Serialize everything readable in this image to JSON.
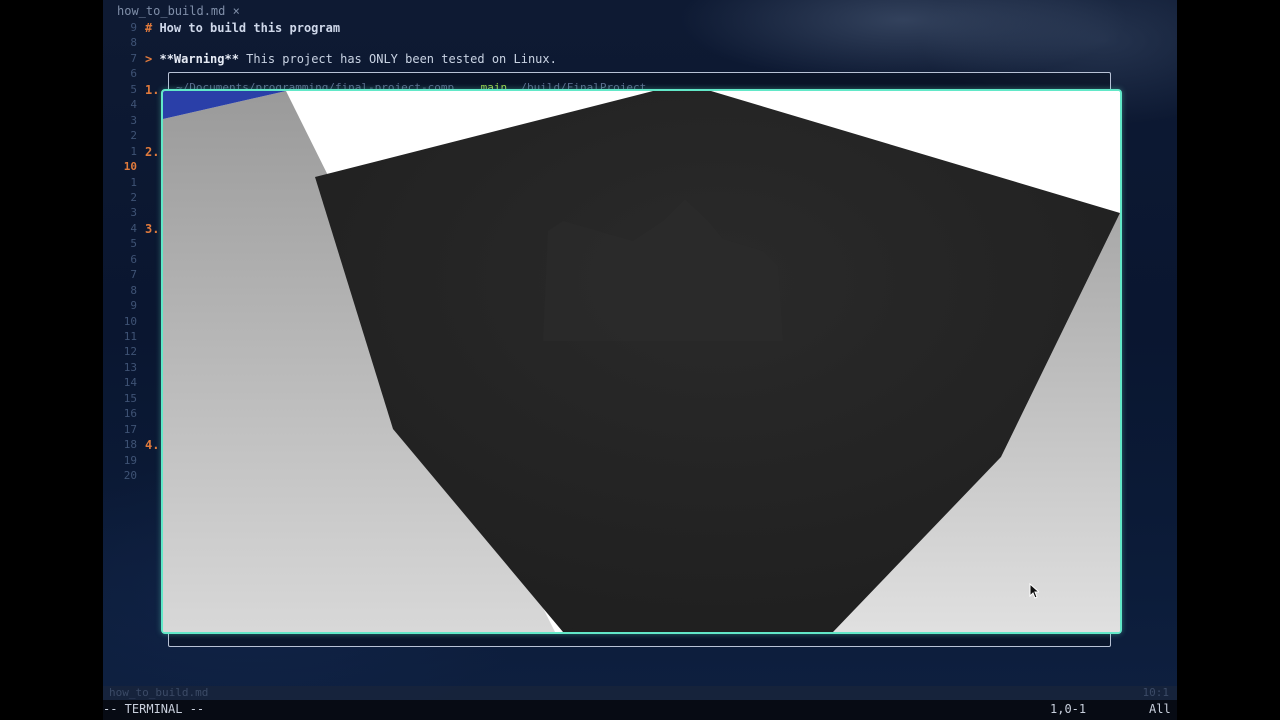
{
  "editor": {
    "tab_label": "how_to_build.md ×",
    "lines": [
      {
        "num": "9",
        "text_hash": "#",
        "text": " How to build this program"
      },
      {
        "num": "8"
      },
      {
        "num": "7",
        "gt": ">",
        "bold": "**Warning**",
        "text": " This project has ONLY been tested on Linux."
      },
      {
        "num": "6"
      },
      {
        "num": "5",
        "marker": "1."
      },
      {
        "num": "4"
      },
      {
        "num": "3"
      },
      {
        "num": "2"
      },
      {
        "num": "1",
        "marker": "2."
      },
      {
        "num": "10",
        "current": true
      },
      {
        "num": "1"
      },
      {
        "num": "2"
      },
      {
        "num": "3"
      },
      {
        "num": "4",
        "marker": "3."
      },
      {
        "num": "5"
      },
      {
        "num": "6"
      },
      {
        "num": "7"
      },
      {
        "num": "8"
      },
      {
        "num": "9"
      },
      {
        "num": "10"
      },
      {
        "num": "11"
      },
      {
        "num": "12"
      },
      {
        "num": "13"
      },
      {
        "num": "14"
      },
      {
        "num": "15"
      },
      {
        "num": "16"
      },
      {
        "num": "17"
      },
      {
        "num": "18",
        "marker": "4."
      },
      {
        "num": "19"
      },
      {
        "num": "20"
      }
    ]
  },
  "terminal": {
    "prompt_path": "~/Documents/programming/final-project-comp...",
    "prompt_branch": "main",
    "prompt_cmd": "./build/FinalProject"
  },
  "render_window": {
    "scene": "3d-cube-interior",
    "colors": {
      "floor_dark": "#262626",
      "wall_light": "#d0d0d0",
      "sky": "#ffffff",
      "accent_blue": "#2a3fa8",
      "border": "#62e8c8"
    }
  },
  "statusline": {
    "filename": "how_to_build.md",
    "position": "10:1"
  },
  "modeline": {
    "mode": "-- TERMINAL --",
    "ruler": "1,0-1",
    "scroll": "All"
  }
}
